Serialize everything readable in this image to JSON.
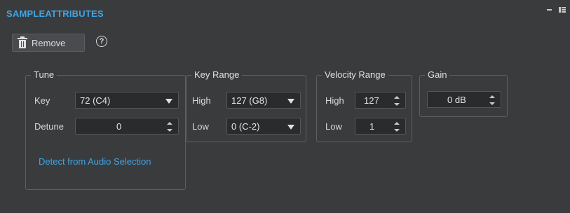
{
  "window": {
    "title": "SAMPLEATTRIBUTES",
    "controls": [
      "minimize-icon",
      "menu-icon"
    ]
  },
  "toolbar": {
    "remove_label": "Remove",
    "help_label": "?"
  },
  "tune": {
    "title": "Tune",
    "key_label": "Key",
    "key_value": "72 (C4)",
    "detune_label": "Detune",
    "detune_value": "0",
    "detect_link": "Detect from Audio Selection"
  },
  "key_range": {
    "title": "Key Range",
    "high_label": "High",
    "high_value": "127 (G8)",
    "low_label": "Low",
    "low_value": "0 (C-2)"
  },
  "velocity_range": {
    "title": "Velocity Range",
    "high_label": "High",
    "high_value": "127",
    "low_label": "Low",
    "low_value": "1"
  },
  "gain": {
    "title": "Gain",
    "value": "0 dB"
  },
  "colors": {
    "accent": "#3fa5e6",
    "background": "#3a3b3d",
    "field": "#2a2b2d"
  }
}
